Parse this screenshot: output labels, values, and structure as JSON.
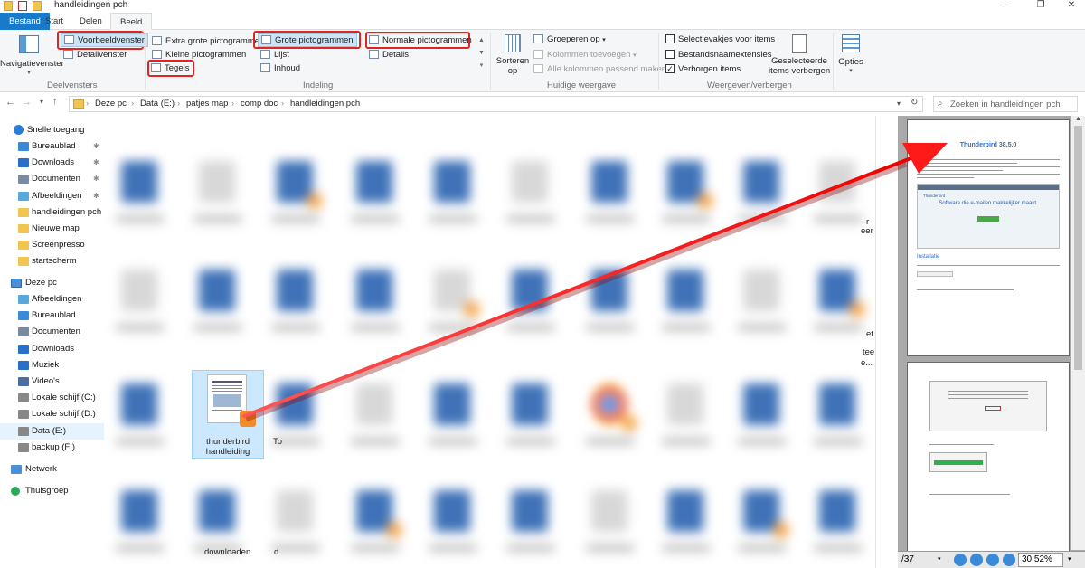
{
  "window": {
    "title": "handleidingen pch",
    "min": "–",
    "max": "❐",
    "close": "✕"
  },
  "tabs": [
    "Bestand",
    "Start",
    "Delen",
    "Beeld"
  ],
  "ribbon": {
    "panes": {
      "nav_pane": "Navigatievenster",
      "preview": "Voorbeeldvenster",
      "details": "Detailvenster",
      "label": "Deelvensters"
    },
    "layout": {
      "xl_icons": "Extra grote pictogrammen",
      "large_icons": "Grote pictogrammen",
      "medium_icons": "Normale pictogrammen",
      "small_icons": "Kleine pictogrammen",
      "list": "Lijst",
      "details": "Details",
      "tiles": "Tegels",
      "content": "Inhoud",
      "label": "Indeling"
    },
    "current_view": {
      "sort_line1": "Sorteren",
      "sort_line2": "op",
      "group_by": "Groeperen op",
      "add_columns": "Kolommen toevoegen",
      "fit_columns": "Alle kolommen passend maken",
      "label": "Huidige weergave"
    },
    "show_hide": {
      "checkboxes": "Selectievakjes voor items",
      "extensions": "Bestandsnaamextensies",
      "hidden": "Verborgen items",
      "hide_selected_line1": "Geselecteerde",
      "hide_selected_line2": "items verbergen",
      "label": "Weergeven/verbergen"
    },
    "options": "Opties"
  },
  "address": {
    "crumbs": [
      "Deze pc",
      "Data (E:)",
      "patjes map",
      "comp doc",
      "handleidingen pch"
    ],
    "search_placeholder": "Zoeken in handleidingen pch"
  },
  "nav": {
    "quick_access": "Snelle toegang",
    "quick_items": [
      "Bureaublad",
      "Downloads",
      "Documenten",
      "Afbeeldingen",
      "handleidingen pch",
      "Nieuwe map",
      "Screenpresso",
      "startscherm"
    ],
    "this_pc": "Deze pc",
    "pc_items": [
      "Afbeeldingen",
      "Bureaublad",
      "Documenten",
      "Downloads",
      "Muziek",
      "Video's",
      "Lokale schijf (C:)",
      "Lokale schijf (D:)",
      "Data (E:)",
      "backup (F:)"
    ],
    "network": "Netwerk",
    "homegroup": "Thuisgroep"
  },
  "content": {
    "selected_file_line1": "thunderbird",
    "selected_file_line2": "handleiding",
    "partial_labels": [
      "To",
      "downloaden",
      "d",
      "r",
      "eer",
      "et",
      "tee",
      "e..."
    ]
  },
  "preview": {
    "doc_title": "Thunderbird 38.5.0",
    "shot_heading": "Software die e-mailen makkelijker maakt.",
    "app_name": "Thunderbird",
    "section": "Installatie",
    "page_count": "/37",
    "zoom": "30.52%"
  },
  "colors": {
    "accent": "#1979ca",
    "highlight_box": "#e02424",
    "arrow": "#ff1a1a"
  }
}
